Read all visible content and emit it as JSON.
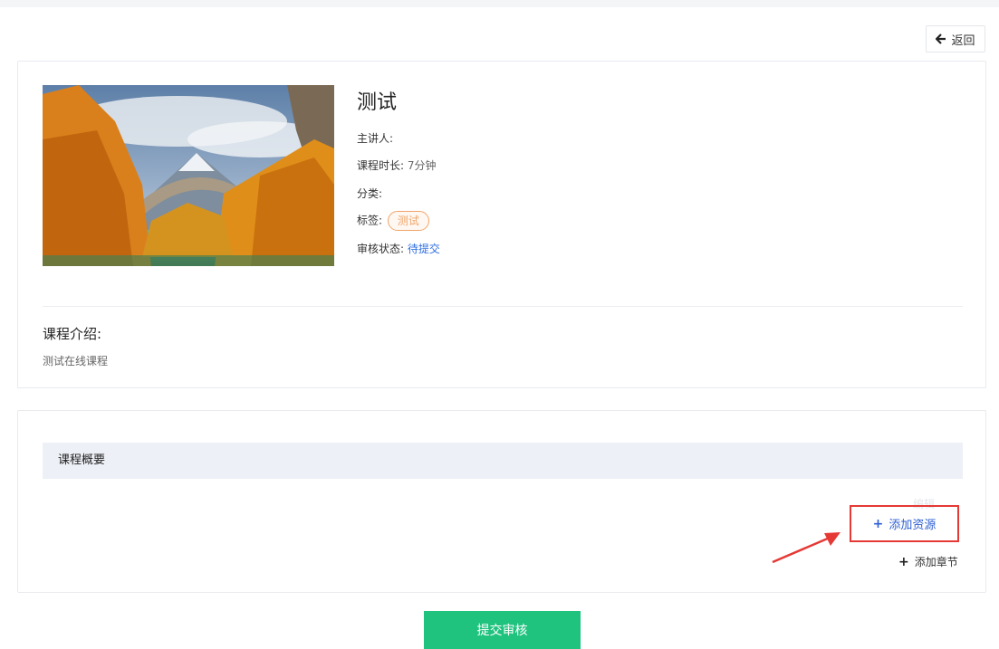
{
  "header": {
    "back_label": "返回"
  },
  "course": {
    "title": "测试",
    "lecturer_label": "主讲人:",
    "lecturer_value": "",
    "duration_label": "课程时长:",
    "duration_value": "7分钟",
    "category_label": "分类:",
    "category_value": "",
    "tags_label": "标签:",
    "tags": [
      "测试"
    ],
    "review_label": "审核状态:",
    "review_value": "待提交"
  },
  "intro": {
    "label": "课程介绍:",
    "text": "测试在线课程"
  },
  "summary": {
    "header": "课程概要",
    "edit_label": "编辑",
    "add_resource_label": "添加资源",
    "add_chapter_label": "添加章节"
  },
  "footer": {
    "submit_label": "提交审核"
  },
  "colors": {
    "accent_green": "#1fc37e",
    "link_blue": "#2d5fd3",
    "highlight_red": "#e53935",
    "tag_orange": "#f0a46a"
  }
}
